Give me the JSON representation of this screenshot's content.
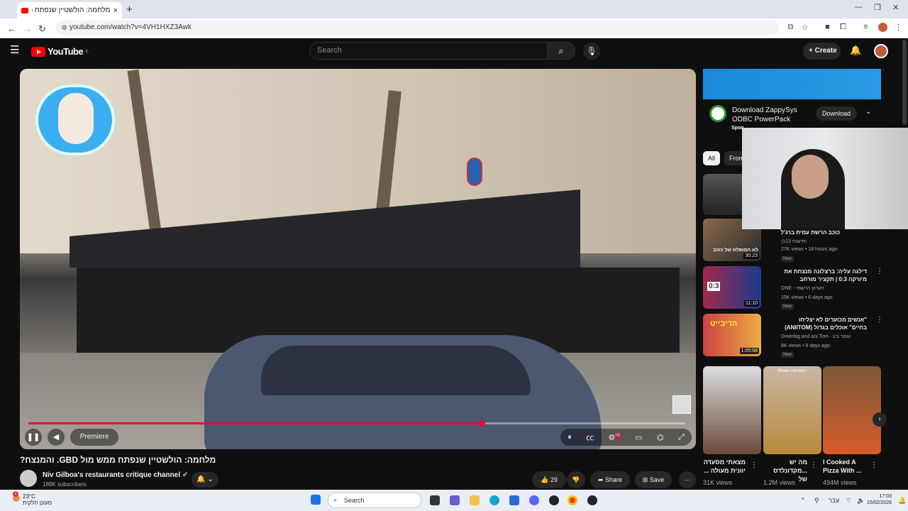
{
  "browser": {
    "tab_title": "מלחמה: הולשטיין שנפתח מ...",
    "url": "youtube.com/watch?v=4VH1HXZ3Awk",
    "new_tab": "+",
    "close_tab": "×"
  },
  "youtube": {
    "logo_text": "YouTube",
    "country_code": "IL",
    "search_placeholder": "Search",
    "create_label": "Create"
  },
  "player": {
    "premiere_label": "Premiere",
    "progress": 0.69,
    "settings_badge": "HD"
  },
  "video": {
    "title": "מלחמה: הולשטיין שנפתח ממש מול GBD. והמנצח?",
    "channel_name": "Niv Gilboa's restaurants critique channel",
    "subscribers": "188K subscribers",
    "like_count": "29",
    "share_label": "Share",
    "save_label": "Save"
  },
  "ad": {
    "title_line1": "Download ZappySys",
    "title_line2": "ODBC PowerPack",
    "sponsored": "Spon",
    "button_label": "Download"
  },
  "chips": [
    "All",
    "From"
  ],
  "recommendations": [
    {
      "title": "כוכב הרשת עמית ברג'ל",
      "channel": "חדשות 13",
      "meta": "27K views • 18 hours ago",
      "badge": "New",
      "duration": "30:23",
      "thumb_text": "לא המופלא של כוכב"
    },
    {
      "title": "דילגה עליה: ברצלונה מנצחת את מיורקה 0:3 | תקציר מורחב",
      "channel": "ONE - הערוץ הרשמי",
      "meta": "15K views • 6 days ago",
      "badge": "New",
      "duration": "11:10",
      "thumb_text": "0:3"
    },
    {
      "title": "\"אנשים מכוערים לא יצליחו בחיים\" אוכלים בגדול (ANIITOM)",
      "channel": "Omerbig and ani Tom - עומר ביג",
      "meta": "8K views • 5 days ago",
      "badge": "New",
      "duration": "1:05:58",
      "thumb_text": "הדיבייט"
    }
  ],
  "shorts": [
    {
      "title": "מצאתי מסעדה יוונית מעולה ...",
      "views": "31K views"
    },
    {
      "title": "מה יש ...מקדונלדס של",
      "views": "1.2M views",
      "thumb_text": "Shake chicken - ..."
    },
    {
      "title": "I Cooked A Pizza With ...",
      "views": "494M views"
    }
  ],
  "taskbar": {
    "temperature": "23°C",
    "weather": "מעונן חלקית",
    "search": "Search",
    "language": "עבר",
    "time": "17:03",
    "date": "15/02/2026",
    "notification_count": "2"
  },
  "colors": {
    "accent_red": "#ff0033",
    "yt_background": "#0f0f0f",
    "chip_selected": "#f1f1f1"
  }
}
